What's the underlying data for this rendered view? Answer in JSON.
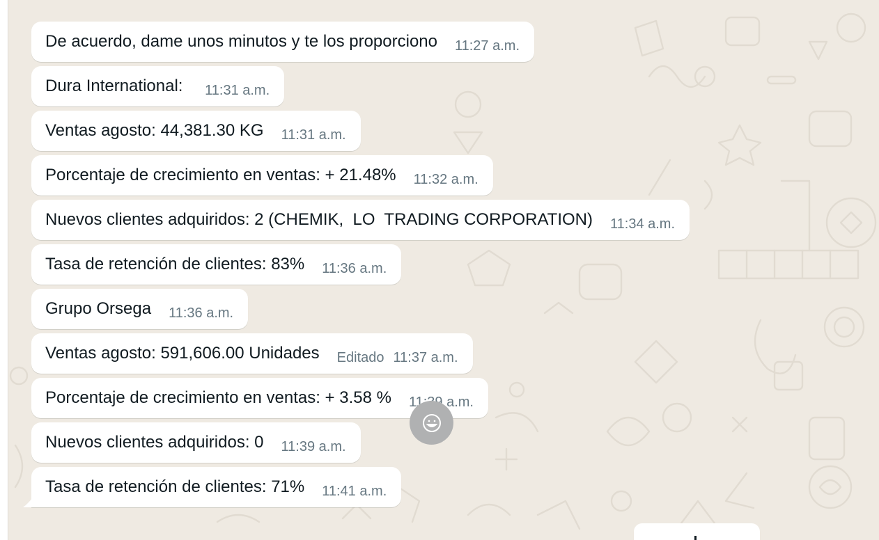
{
  "chat": {
    "messages": [
      {
        "text": "De acuerdo, dame unos minutos y te los proporciono",
        "time": "11:27 a.m."
      },
      {
        "text": "Dura International: ",
        "time": "11:31 a.m."
      },
      {
        "text": "Ventas agosto: 44,381.30 KG",
        "time": "11:31 a.m."
      },
      {
        "text": "Porcentaje de crecimiento en ventas: + 21.48%",
        "time": "11:32 a.m."
      },
      {
        "text": "Nuevos clientes adquiridos: 2 (CHEMIK,  LO  TRADING CORPORATION)",
        "time": "11:34 a.m."
      },
      {
        "text": "Tasa de retención de clientes: 83%",
        "time": "11:36 a.m."
      },
      {
        "text": "Grupo Orsega",
        "time": "11:36 a.m."
      },
      {
        "text": "Ventas agosto: 591,606.00 Unidades",
        "edited": "Editado",
        "time": "11:37 a.m."
      },
      {
        "text": "Porcentaje de crecimiento en ventas: + 3.58 %",
        "time": "11:39 a.m."
      },
      {
        "text": "Nuevos clientes adquiridos: 0",
        "time": "11:39 a.m."
      },
      {
        "text": "Tasa de retención de clientes: 71%",
        "time": "11:41 a.m."
      }
    ]
  },
  "icons": {
    "reaction": "smiley-face-icon",
    "tail": "bubble-tail-icon"
  },
  "colors": {
    "wallpaper": "#efeae2",
    "bubble_incoming": "#ffffff",
    "text_primary": "#111b21",
    "text_meta": "#667781",
    "reaction_button": "#b0b1b2"
  }
}
